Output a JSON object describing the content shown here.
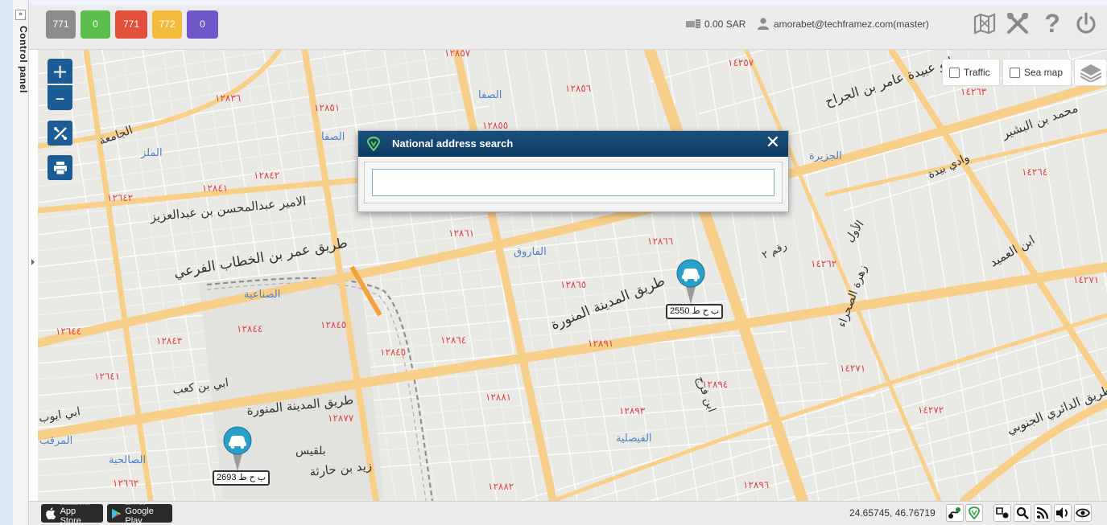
{
  "control_panel": {
    "label": "Control panel",
    "toggle": "»"
  },
  "status_badges": [
    {
      "label": "771",
      "color": "#8c8c8c"
    },
    {
      "label": "0",
      "color": "#5cbf4b"
    },
    {
      "label": "771",
      "color": "#e4503b"
    },
    {
      "label": "772",
      "color": "#f5bb3d"
    },
    {
      "label": "0",
      "color": "#6e58c9"
    }
  ],
  "header": {
    "balance": "0.00 SAR",
    "user": "amorabet@techframez.com(master)",
    "icons": [
      "map-book-icon",
      "tools-icon",
      "help-icon",
      "power-icon"
    ],
    "help_glyph": "?"
  },
  "map_tools": {
    "zoom_in": "+",
    "zoom_out": "–",
    "icons": [
      "measure-icon",
      "print-icon"
    ]
  },
  "layers": {
    "traffic": "Traffic",
    "sea_map": "Sea map"
  },
  "vehicles": [
    {
      "plate": "ب ح ط 2550"
    },
    {
      "plate": "ب ح ط 2693"
    }
  ],
  "dialog": {
    "title": "National address search",
    "close": "✕",
    "input_value": "",
    "input_placeholder": ""
  },
  "footer": {
    "app_store_small": "Download on the",
    "app_store": "App Store",
    "google_play_small": "GET IT ON",
    "google_play": "Google Play",
    "coordinates": "24.65745, 46.76719",
    "tool_icons": [
      "route-icon",
      "shield-icon",
      "geofence-icon",
      "search-icon",
      "rss-icon",
      "sound-icon",
      "eye-icon"
    ]
  },
  "map_labels": [
    {
      "text": "طريق عمر بن الخطاب الفرعي"
    },
    {
      "text": "طريق المدينة المنورة"
    },
    {
      "text": "طريق المدينة المنورة"
    },
    {
      "text": "الامير عبدالمحسن بن عبدالعزيز"
    },
    {
      "text": "ابو عبيدة عامر بن الجراح"
    },
    {
      "text": "محمد بن البشير"
    },
    {
      "text": "وادي بيدة"
    },
    {
      "text": "ابن العميد"
    },
    {
      "text": "الأول"
    },
    {
      "text": "زهرة الصحراء"
    },
    {
      "text": "ابن فرج"
    },
    {
      "text": "طريق الدائري الجنوبي"
    },
    {
      "text": "ابي بن كعب"
    },
    {
      "text": "بلقيس"
    },
    {
      "text": "زيد بن حارثة"
    },
    {
      "text": "الصفا"
    },
    {
      "text": "الملز"
    },
    {
      "text": "الجزيرة"
    },
    {
      "text": "الفاروق"
    },
    {
      "text": "الصناعية"
    },
    {
      "text": "الفيصلية"
    },
    {
      "text": "الصالحية"
    },
    {
      "text": "المرقب"
    },
    {
      "text": "الجامعة"
    },
    {
      "text": "ابي ايوب"
    },
    {
      "text": "رقم ٢"
    },
    {
      "text": "١٢٨٥٧"
    },
    {
      "text": "١٢٨٣٦"
    },
    {
      "text": "١٢٨٥١"
    },
    {
      "text": "١٢٨٥٦"
    },
    {
      "text": "١٤٢٥٧"
    },
    {
      "text": "١٢٨٥٥"
    },
    {
      "text": "١٤٢٦٣"
    },
    {
      "text": "١٢٨٤٢"
    },
    {
      "text": "١٢٨٤١"
    },
    {
      "text": "١٢٦٤٢"
    },
    {
      "text": "١٤٢٦٤"
    },
    {
      "text": "١٢٨٦١"
    },
    {
      "text": "١٢٨٦٦"
    },
    {
      "text": "١٤٢٦٢"
    },
    {
      "text": "١٢٨٦٥"
    },
    {
      "text": "١٤٢٧١"
    },
    {
      "text": "١٢٦٤٤"
    },
    {
      "text": "١٢٨٤٣"
    },
    {
      "text": "١٢٨٤٤"
    },
    {
      "text": "١٢٨٤٥"
    },
    {
      "text": "١٢٨٦٤"
    },
    {
      "text": "١٢٨٩١"
    },
    {
      "text": "١٢٨٤٥"
    },
    {
      "text": "١٢٦٤١"
    },
    {
      "text": "١٢٨٩٤"
    },
    {
      "text": "١٤٢٧١"
    },
    {
      "text": "١٢٨٨١"
    },
    {
      "text": "١٢٨٧٧"
    },
    {
      "text": "١٢٨٩٣"
    },
    {
      "text": "١٤٢٧٢"
    },
    {
      "text": "١٢٨٨٢"
    },
    {
      "text": "١٢٨٩٦"
    },
    {
      "text": "١٢٦٦٢"
    }
  ]
}
